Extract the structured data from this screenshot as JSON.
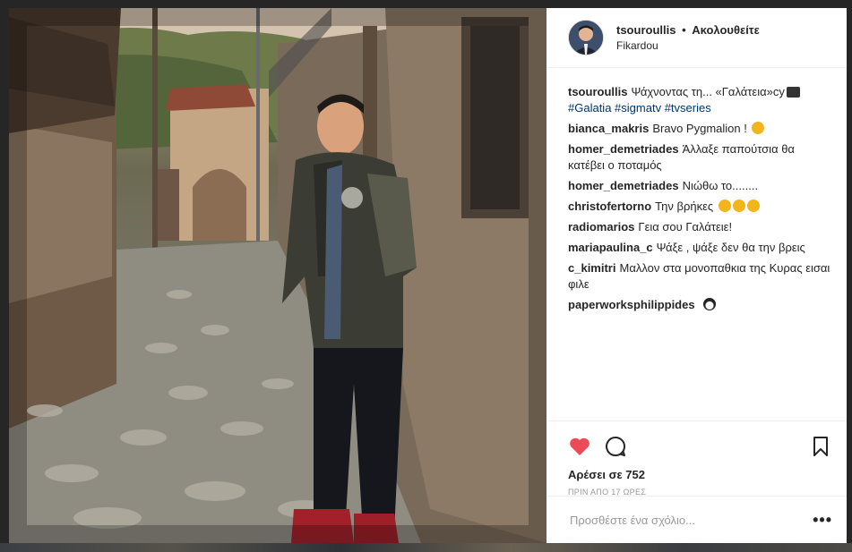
{
  "post": {
    "username": "tsouroullis",
    "separator": "•",
    "follow_status": "Ακολουθείτε",
    "location": "Fikardou",
    "caption": {
      "user": "tsouroullis",
      "text": "Ψάχνοντας τη... «Γαλάτεια»",
      "suffix": "cy",
      "tags": [
        "#Galatia",
        "#sigmatv",
        "#tvseries"
      ]
    },
    "comments": [
      {
        "user": "bianca_makris",
        "text": "Bravo Pygmalion !",
        "emoji": "grin"
      },
      {
        "user": "homer_demetriades",
        "text": "Άλλαξε παπούτσια θα κατέβει ο ποταμός",
        "emoji": ""
      },
      {
        "user": "homer_demetriades",
        "text": "Νιώθω το........",
        "emoji": ""
      },
      {
        "user": "christofertorno",
        "text": "Την βρήκες",
        "emoji": "thinking x3"
      },
      {
        "user": "radiomarios",
        "text": "Γεια σου Γαλάτειε!",
        "emoji": ""
      },
      {
        "user": "mariapaulina_c",
        "text": "Ψάξε , ψάξε δεν θα την βρεις",
        "emoji": ""
      },
      {
        "user": "c_kimitri",
        "text": "Μαλλον στα μονοπαθκια της Κυρας εισαι φιλε",
        "emoji": ""
      },
      {
        "user": "paperworksphilippides",
        "text": "",
        "emoji": "penguin"
      }
    ],
    "likes_text": "Αρέσει σε 752",
    "time_ago": "ΠΡΙΝ ΑΠΟ 17 ΩΡΕΣ",
    "comment_placeholder": "Προσθέστε ένα σχόλιο...",
    "more_label": "•••",
    "liked": true
  },
  "icons": {
    "like": "heart-icon",
    "comment": "comment-bubble-icon",
    "save": "bookmark-icon",
    "more": "more-options-icon"
  },
  "colors": {
    "like_red": "#ed4956",
    "hashtag": "#003569",
    "text": "#262626",
    "muted": "#999999"
  }
}
